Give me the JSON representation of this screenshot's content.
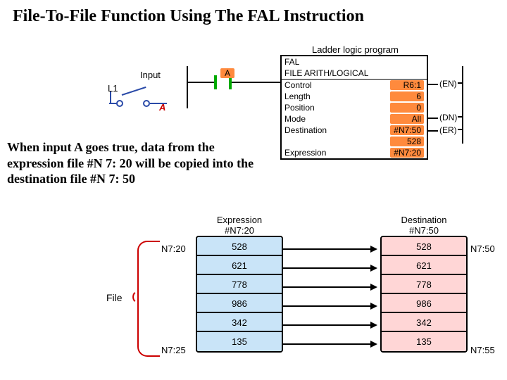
{
  "title": "File-To-File Function Using The FAL Instruction",
  "ladder_program_label": "Ladder logic program",
  "input_section_label": "Input",
  "L1": "L1",
  "contact_A": "A",
  "rung_contact_A": "A",
  "fal": {
    "mnemonic": "FAL",
    "name": "FILE ARITH/LOGICAL",
    "rows": {
      "control_label": "Control",
      "control_val": "R6:1",
      "length_label": "Length",
      "length_val": "6",
      "position_label": "Position",
      "position_val": "0",
      "mode_label": "Mode",
      "mode_val": "All",
      "destination_label": "Destination",
      "destination_val": "#N7:50",
      "dest_second_val": "528",
      "expression_label": "Expression",
      "expression_val": "#N7:20"
    },
    "pins": {
      "en": "(EN)",
      "dn": "(DN)",
      "er": "(ER)"
    }
  },
  "paragraph": "When input A goes true, data from the expression file #N 7: 20 will be copied into the destination file #N 7: 50",
  "expression_table": {
    "title_l1": "Expression",
    "title_l2": "#N7:20",
    "start_addr": "N7:20",
    "end_addr": "N7:25",
    "values": [
      "528",
      "621",
      "778",
      "986",
      "342",
      "135"
    ]
  },
  "destination_table": {
    "title_l1": "Destination",
    "title_l2": "#N7:50",
    "start_addr": "N7:50",
    "end_addr": "N7:55",
    "values": [
      "528",
      "621",
      "778",
      "986",
      "342",
      "135"
    ]
  },
  "file_brace_label": "File"
}
